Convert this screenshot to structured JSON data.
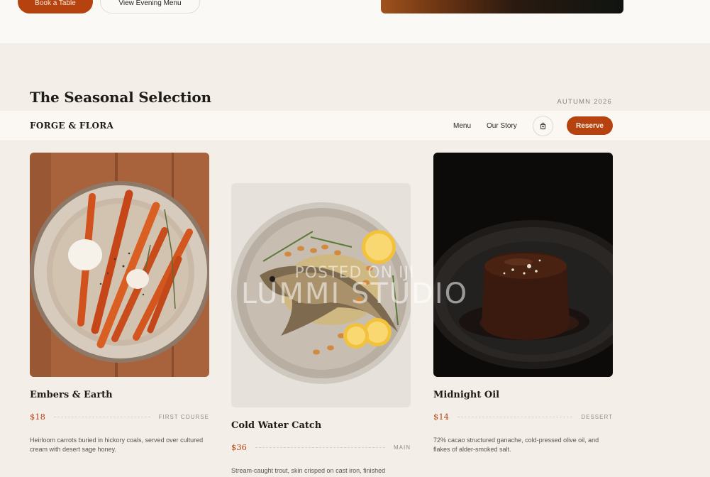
{
  "hero": {
    "primary_button": "Book a Table",
    "secondary_button": "View Evening Menu"
  },
  "section": {
    "title": "The Seasonal Selection",
    "season": "AUTUMN 2026"
  },
  "nav": {
    "brand": "FORGE & FLORA",
    "links": [
      "Menu",
      "Our Story"
    ],
    "cart_icon": "shopping-bag-icon",
    "reserve": "Reserve"
  },
  "dishes": [
    {
      "name": "Embers & Earth",
      "price": "$18",
      "course": "FIRST COURSE",
      "description": "Heirloom carrots buried in hickory coals, served over cultured cream with desert sage honey."
    },
    {
      "name": "Cold Water Catch",
      "price": "$36",
      "course": "MAIN",
      "description": "Stream-caught trout, skin crisped on cast iron, finished"
    },
    {
      "name": "Midnight Oil",
      "price": "$14",
      "course": "DESSERT",
      "description": "72% cacao structured ganache, cold-pressed olive oil, and flakes of alder-smoked salt."
    }
  ],
  "watermark": {
    "line1": "POSTED ON IJI",
    "line2": "LUMMI STUDIO"
  },
  "colors": {
    "accent": "#b5420f",
    "background": "#f3efe8",
    "surface": "#fbf8f3"
  }
}
